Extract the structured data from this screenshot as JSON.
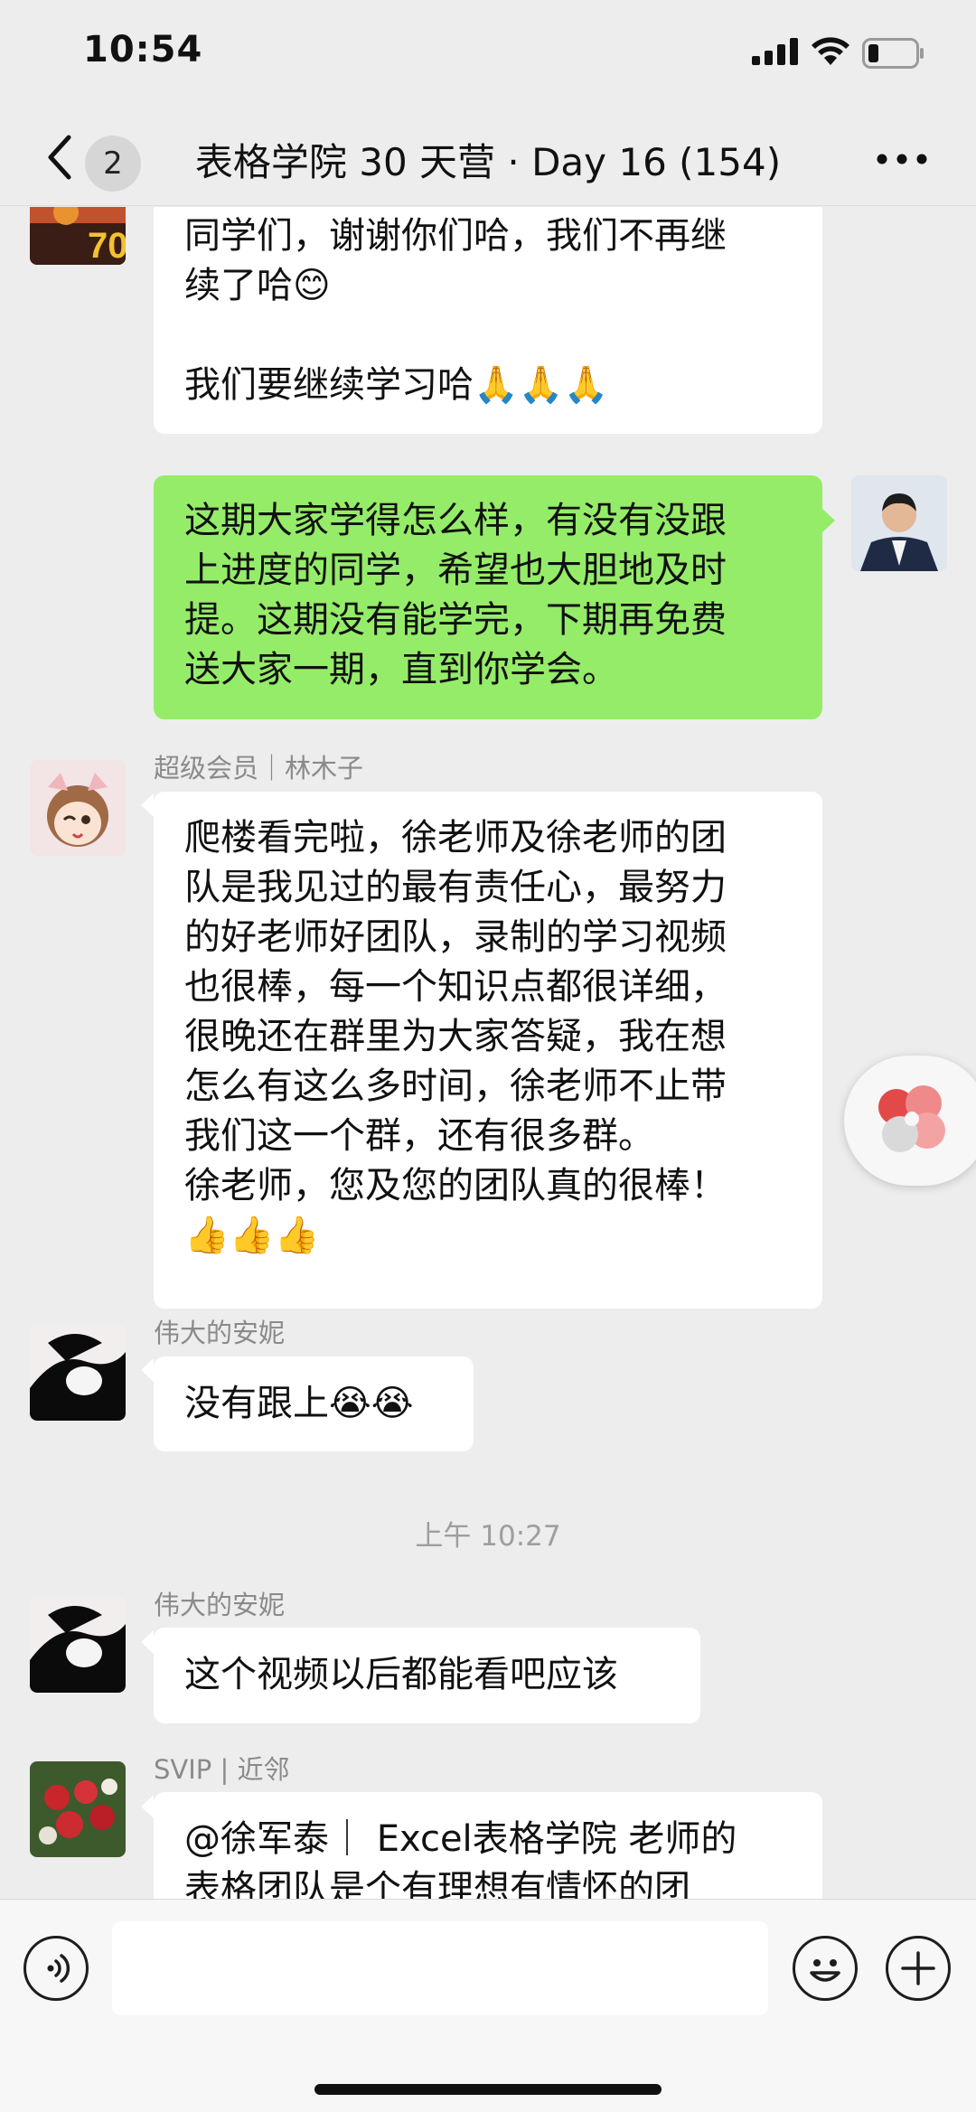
{
  "status_bar": {
    "time": "10:54"
  },
  "nav": {
    "unread_count": "2",
    "title": "表格学院 30 天营 · Day 16 (154)"
  },
  "messages": [
    {
      "lines": [
        "同学们，谢谢你们哈，我们不再继",
        "续了哈😊",
        "",
        "我们要继续学习哈🙏🙏🙏"
      ]
    },
    {
      "lines": [
        "这期大家学得怎么样，有没有没跟",
        "上进度的同学，希望也大胆地及时",
        "提。这期没有能学完，下期再免费",
        "送大家一期，直到你学会。"
      ]
    },
    {
      "sender": "超级会员｜林木子",
      "lines": [
        "爬楼看完啦，徐老师及徐老师的团",
        "队是我见过的最有责任心，最努力",
        "的好老师好团队，录制的学习视频",
        "也很棒，每一个知识点都很详细，",
        "很晚还在群里为大家答疑，我在想",
        "怎么有这么多时间，徐老师不止带",
        "我们这一个群，还有很多群。",
        "徐老师，您及您的团队真的很棒！",
        "👍👍👍"
      ]
    },
    {
      "sender": "伟大的安妮",
      "lines": [
        "没有跟上😭😭"
      ]
    },
    {
      "sender": "伟大的安妮",
      "lines": [
        "这个视频以后都能看吧应该"
      ]
    },
    {
      "sender": "SVIP | 近邻",
      "lines": [
        "@徐军泰｜ Excel表格学院 老师的",
        "表格团队是个有理想有情怀的团"
      ]
    }
  ],
  "timestamp": "上午 10:27",
  "icons": {
    "back": "chevron-left-icon",
    "more": "more-dots-icon",
    "voice": "voice-icon",
    "emoji": "emoji-icon",
    "plus": "plus-icon",
    "float": "floating-window-icon"
  }
}
